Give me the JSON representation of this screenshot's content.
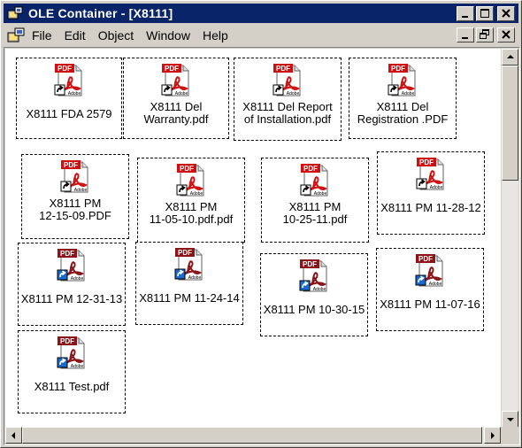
{
  "window": {
    "title": "OLE Container - [X8111]",
    "controls": {
      "minimize_icon": "minimize-icon",
      "maximize_icon": "maximize-icon",
      "close_icon": "close-icon"
    }
  },
  "menubar": {
    "items": [
      "File",
      "Edit",
      "Object",
      "Window",
      "Help"
    ],
    "mdi_controls": {
      "minimize_icon": "minimize-icon",
      "restore_icon": "restore-icon",
      "close_icon": "close-icon"
    }
  },
  "icon": {
    "name": "pdf-icon",
    "badge_text": "PDF",
    "brand_text": "Adobe",
    "shortcut_icon": "shortcut-arrow-icon"
  },
  "colors": {
    "pdf_red": "#d01010",
    "pdf_dark_red": "#8a1418",
    "titlebar": "#0a246a",
    "shortcut_blue": "#1a6ad0"
  },
  "items": [
    {
      "lines": [
        "X8111 FDA 2579"
      ],
      "style": "red"
    },
    {
      "lines": [
        "X8111 Del",
        "Warranty.pdf"
      ],
      "style": "red"
    },
    {
      "lines": [
        "X8111 Del Report",
        "of Installation.pdf"
      ],
      "style": "red"
    },
    {
      "lines": [
        "X8111 Del",
        "Registration .PDF"
      ],
      "style": "red"
    },
    {
      "lines": [
        "X8111 PM",
        "12-15-09.PDF"
      ],
      "style": "red"
    },
    {
      "lines": [
        "X8111 PM",
        "11-05-10.pdf.pdf"
      ],
      "style": "red"
    },
    {
      "lines": [
        "X8111 PM",
        "10-25-11.pdf"
      ],
      "style": "red"
    },
    {
      "lines": [
        "X8111 PM 11-28-12"
      ],
      "style": "red"
    },
    {
      "lines": [
        "X8111 PM 12-31-13"
      ],
      "style": "blue"
    },
    {
      "lines": [
        "X8111 PM 11-24-14"
      ],
      "style": "dark"
    },
    {
      "lines": [
        "X8111 PM 10-30-15"
      ],
      "style": "blue"
    },
    {
      "lines": [
        "X8111 PM 11-07-16"
      ],
      "style": "dark"
    },
    {
      "lines": [
        "X8111 Test.pdf"
      ],
      "style": "blue"
    }
  ]
}
